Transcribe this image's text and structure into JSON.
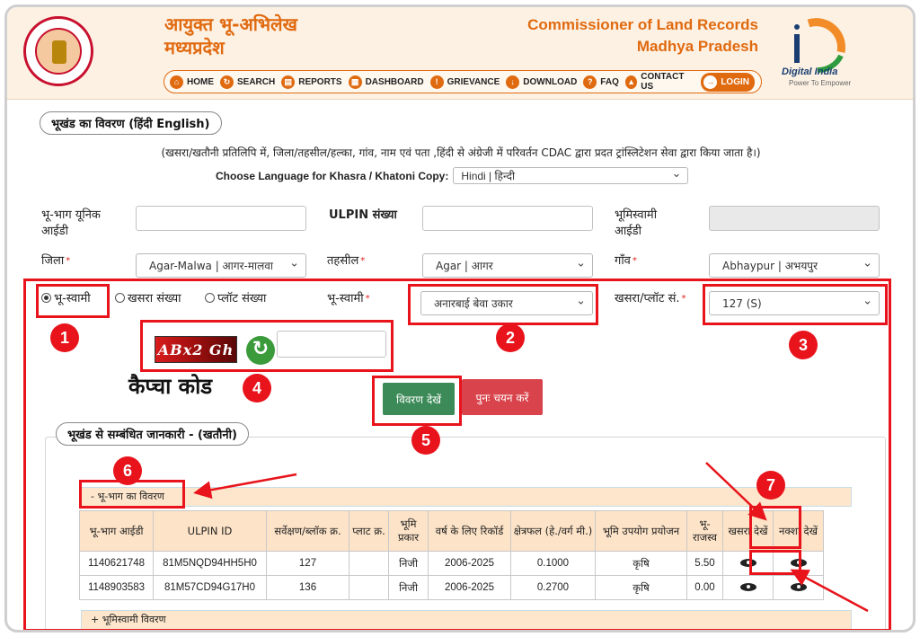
{
  "header": {
    "hi_line1": "आयुक्त भू-अभिलेख",
    "hi_line2": "मध्यप्रदेश",
    "en_line1": "Commissioner of Land Records",
    "en_line2": "Madhya Pradesh",
    "di_name": "Digital India",
    "di_tagline": "Power To Empower"
  },
  "nav": {
    "items": [
      "HOME",
      "SEARCH",
      "REPORTS",
      "DASHBOARD",
      "GRIEVANCE",
      "DOWNLOAD",
      "FAQ",
      "CONTACT US"
    ],
    "login": "LOGIN"
  },
  "section1": {
    "title": "भूखंड का विवरण  (हिंदी  English)",
    "note": "(खसरा/खतौनी प्रतिलिपि में, जिला/तहसील/हल्का, गांव, नाम एवं पता ,हिंदी से अंग्रेजी में परिवर्तन CDAC द्वारा प्रदत ट्रांस्लिटेशन सेवा द्वारा किया जाता है।)",
    "lang_label": "Choose Language for Khasra / Khatoni Copy:",
    "lang_value": "Hindi | हिन्दी"
  },
  "form": {
    "unique_id_label_1": "भू-भाग यूनिक",
    "unique_id_label_2": "आईडी",
    "ulpin_label": "ULPIN संख्या",
    "owner_id_label_1": "भूमिस्वामी",
    "owner_id_label_2": "आईडी",
    "district_label": "जिला",
    "district_value": "Agar-Malwa | आगर-मालवा",
    "tehsil_label": "तहसील",
    "tehsil_value": "Agar | आगर",
    "village_label": "गाँव",
    "village_value": "Abhaypur | अभयपुर",
    "radio_owner": "भू-स्वामी",
    "radio_khasra": "खसरा संख्या",
    "radio_plot": "प्लॉट संख्या",
    "owner_label": "भू-स्वामी",
    "owner_value": "अनारबाई बेवा उकार",
    "khasra_label": "खसरा/प्लॉट सं.",
    "khasra_value": "127 (S)",
    "captcha_image_text": "ABx2 Gh",
    "captcha_label": "कैप्चा कोड",
    "view_button": "विवरण देखें",
    "reset_button": "पुनः चयन करें"
  },
  "section2": {
    "title": "भूखंड से सम्बंधित जानकारी -   (खतौनी)",
    "land_bar": "- भू-भाग का विवरण",
    "owner_bar": "+ भूमिस्वामी विवरण"
  },
  "table": {
    "headers": [
      "भू-भाग आईडी",
      "ULPIN ID",
      "सर्वेक्षण/ब्लॉक क्र.",
      "प्लाट क्र.",
      "भूमि प्रकार",
      "वर्ष के लिए रिकॉर्ड",
      "क्षेत्रफल (हे./वर्ग मी.)",
      "भूमि उपयोग प्रयोजन",
      "भू-राजस्व",
      "खसरा देखें",
      "नक्शा देखें"
    ],
    "rows": [
      [
        "1140621748",
        "81M5NQD94HH5H0",
        "127",
        "",
        "निजी",
        "2006-2025",
        "0.1000",
        "कृषि",
        "5.50"
      ],
      [
        "1148903583",
        "81M57CD94G17H0",
        "136",
        "",
        "निजी",
        "2006-2025",
        "0.2700",
        "कृषि",
        "0.00"
      ]
    ]
  },
  "annotations": {
    "badges": [
      "1",
      "2",
      "3",
      "4",
      "5",
      "6",
      "7"
    ]
  }
}
